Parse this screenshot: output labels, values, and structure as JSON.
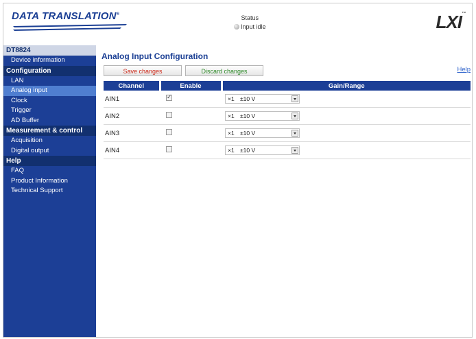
{
  "header": {
    "brand": "DATA TRANSLATION",
    "brand_mark": "®",
    "status_label": "Status",
    "status_value": "Input idle",
    "lxi_logo": "LXI",
    "lxi_mark": "™"
  },
  "sidebar": {
    "device": "DT8824",
    "device_items": [
      "Device information"
    ],
    "groups": [
      {
        "label": "Configuration",
        "items": [
          "LAN",
          "Analog input",
          "Clock",
          "Trigger",
          "AD Buffer"
        ]
      },
      {
        "label": "Measurement & control",
        "items": [
          "Acquisition",
          "Digital output"
        ]
      },
      {
        "label": "Help",
        "items": [
          "FAQ",
          "Product Information",
          "Technical Support"
        ]
      }
    ],
    "active_item": "Analog input"
  },
  "main": {
    "title": "Analog Input Configuration",
    "save_label": "Save changes",
    "discard_label": "Discard changes",
    "help_label": "Help",
    "table": {
      "headers": [
        "Channel",
        "Enable",
        "Gain/Range"
      ],
      "rows": [
        {
          "channel": "AIN1",
          "enabled": true,
          "gain": "×1",
          "range": "±10 V"
        },
        {
          "channel": "AIN2",
          "enabled": false,
          "gain": "×1",
          "range": "±10 V"
        },
        {
          "channel": "AIN3",
          "enabled": false,
          "gain": "×1",
          "range": "±10 V"
        },
        {
          "channel": "AIN4",
          "enabled": false,
          "gain": "×1",
          "range": "±10 V"
        }
      ]
    }
  },
  "colors": {
    "brand_blue": "#1b3f94",
    "sidebar_bg": "#1c3f96",
    "active_item": "#4f7ed0",
    "save_text": "#cc2a1a",
    "discard_text": "#2f8a2a"
  }
}
